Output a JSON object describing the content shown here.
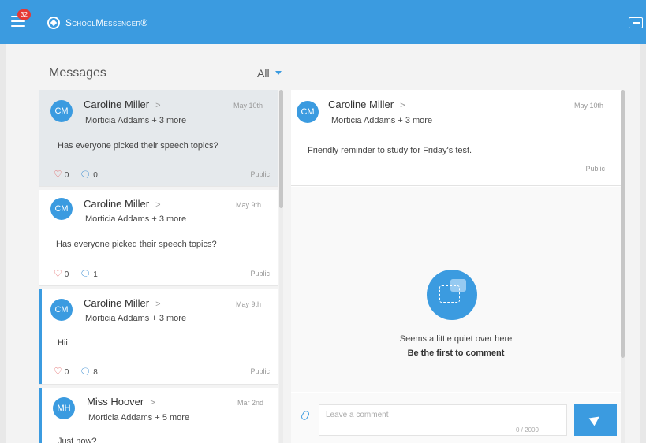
{
  "header": {
    "notification_count": "32",
    "brand": "SchoolMessenger®",
    "menu_icon": "hamburger-menu-icon",
    "exit_icon": "sign-out-icon",
    "accent_color": "#3b9be0"
  },
  "messages_panel": {
    "title": "Messages",
    "filter_label": "All",
    "items": [
      {
        "initials": "CM",
        "sender": "Caroline Miller",
        "chevron": ">",
        "recipients": "Morticia Addams + 3 more",
        "date": "May 10th",
        "body": "Has everyone picked their speech topics?",
        "likes": "0",
        "comments": "0",
        "visibility": "Public"
      },
      {
        "initials": "CM",
        "sender": "Caroline Miller",
        "chevron": ">",
        "recipients": "Morticia Addams + 3 more",
        "date": "May 9th",
        "body": "Has everyone picked their speech topics?",
        "likes": "0",
        "comments": "1",
        "visibility": "Public"
      },
      {
        "initials": "CM",
        "sender": "Caroline Miller",
        "chevron": ">",
        "recipients": "Morticia Addams + 3 more",
        "date": "May 9th",
        "body": "Hii",
        "likes": "0",
        "comments": "8",
        "visibility": "Public"
      },
      {
        "initials": "MH",
        "sender": "Miss Hoover",
        "chevron": ">",
        "recipients": "Morticia Addams + 5 more",
        "date": "Mar 2nd",
        "body": "Just now?"
      }
    ]
  },
  "detail": {
    "initials": "CM",
    "sender": "Caroline Miller",
    "chevron": ">",
    "recipients": "Morticia Addams + 3 more",
    "date": "May 10th",
    "body": "Friendly reminder to study for Friday's test.",
    "visibility": "Public",
    "empty_title": "Seems a little quiet over here",
    "empty_cta": "Be the first to comment",
    "comment_placeholder": "Leave a comment",
    "char_counter": "0 / 2000"
  }
}
